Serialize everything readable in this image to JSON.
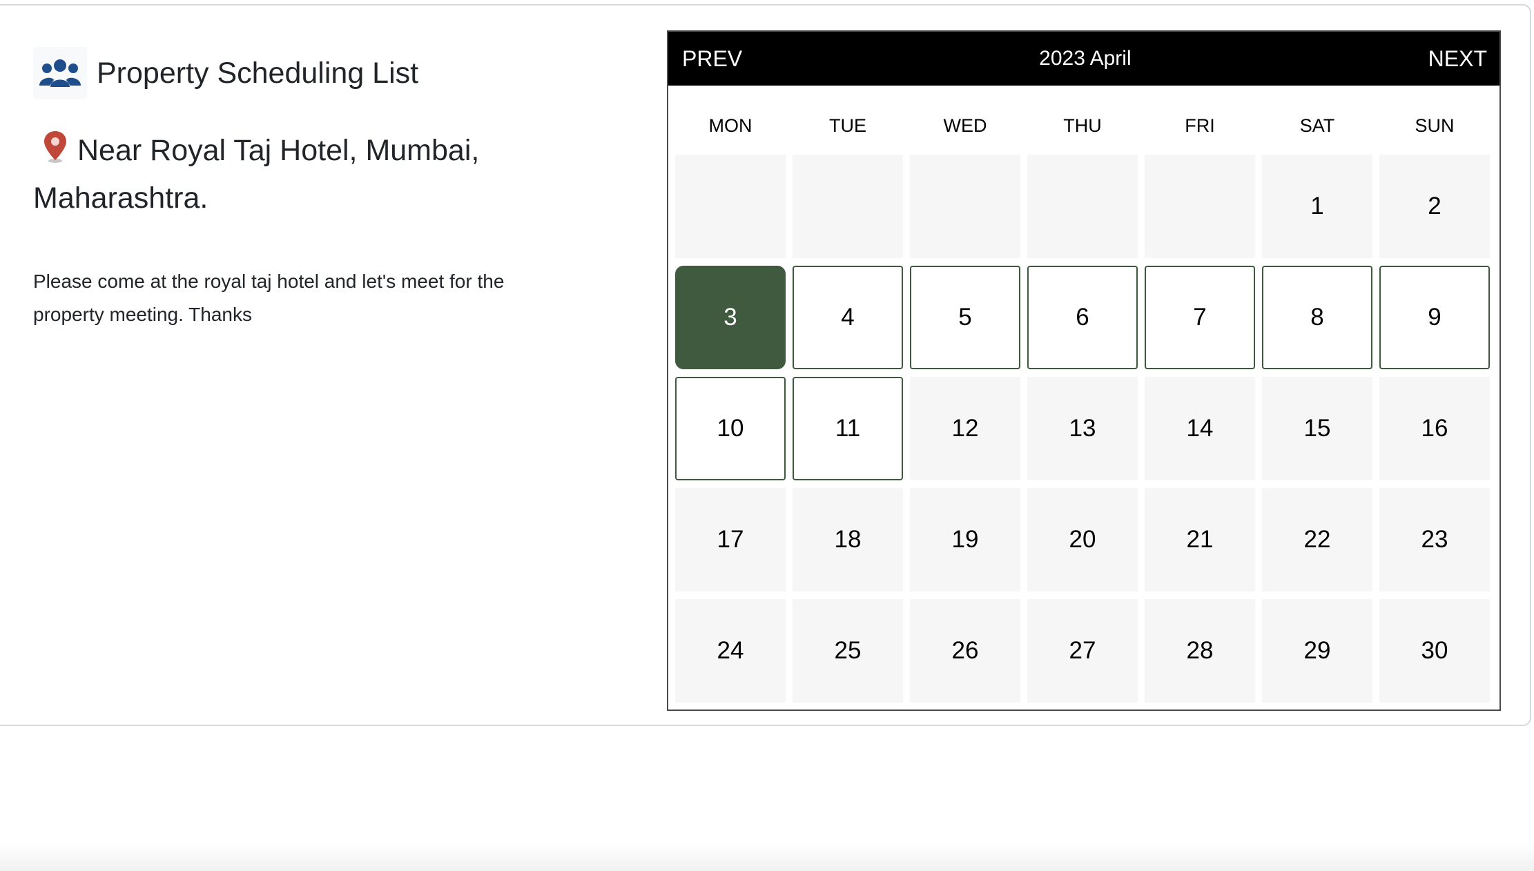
{
  "header": {
    "title": "Property Scheduling List",
    "title_icon": "users-icon"
  },
  "location": {
    "icon": "map-pin-icon",
    "address": "Near Royal Taj Hotel, Mumbai, Maharashtra."
  },
  "message": "Please come at the royal taj hotel and let's meet for the property meeting. Thanks",
  "calendar": {
    "prev_label": "PREV",
    "next_label": "NEXT",
    "title": "2023 April",
    "weekdays": [
      "MON",
      "TUE",
      "WED",
      "THU",
      "FRI",
      "SAT",
      "SUN"
    ],
    "leading_blank_days": 5,
    "days": [
      "1",
      "2",
      "3",
      "4",
      "5",
      "6",
      "7",
      "8",
      "9",
      "10",
      "11",
      "12",
      "13",
      "14",
      "15",
      "16",
      "17",
      "18",
      "19",
      "20",
      "21",
      "22",
      "23",
      "24",
      "25",
      "26",
      "27",
      "28",
      "29",
      "30"
    ],
    "selected_day": "3",
    "available_days": [
      "4",
      "5",
      "6",
      "7",
      "8",
      "9",
      "10",
      "11"
    ],
    "colors": {
      "selected": "#3f5a3e",
      "header_bg": "#000000",
      "cell_bg": "#f6f6f6"
    }
  }
}
